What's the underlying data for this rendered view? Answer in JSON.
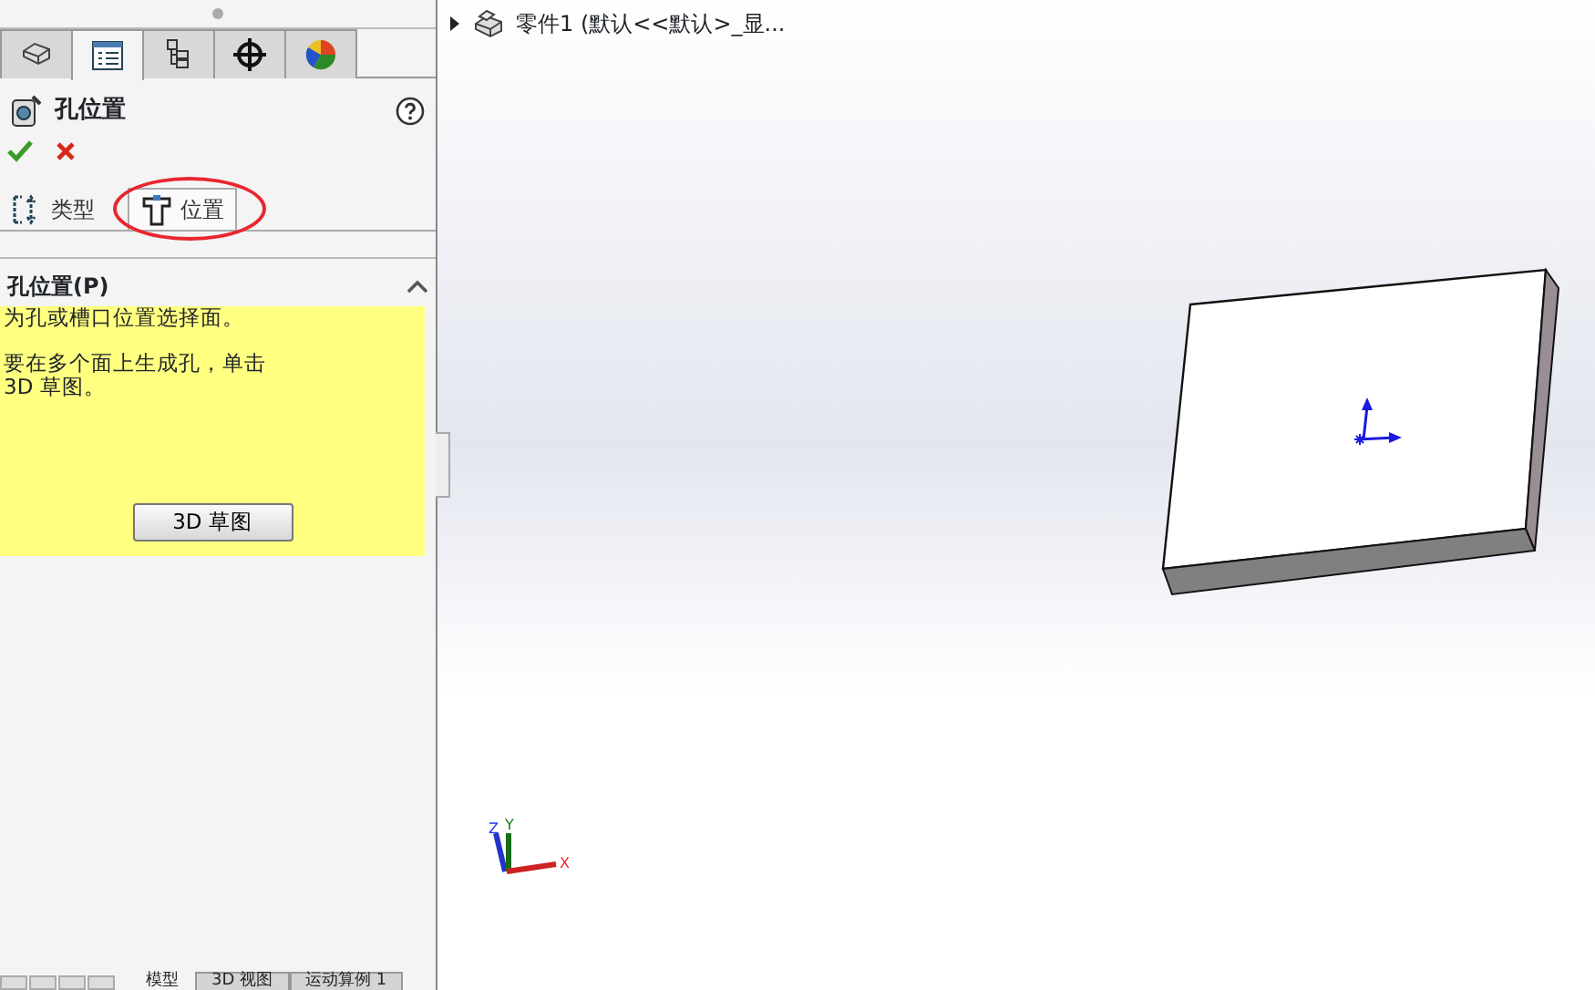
{
  "panel_tabs": [
    {
      "kind": "feature-tree",
      "selected": false
    },
    {
      "kind": "property",
      "selected": true
    },
    {
      "kind": "config",
      "selected": false
    },
    {
      "kind": "dimxpert",
      "selected": false
    },
    {
      "kind": "display",
      "selected": false
    }
  ],
  "property_manager": {
    "title": "孔位置"
  },
  "sub_tabs": [
    {
      "label": "类型",
      "kind": "type",
      "selected": false,
      "circled": false
    },
    {
      "label": "位置",
      "kind": "position",
      "selected": true,
      "circled": true
    }
  ],
  "section": {
    "title": "孔位置(P)",
    "expanded": true,
    "messages": [
      "为孔或槽口位置选择面。",
      "要在多个面上生成孔，单击\n3D 草图。"
    ],
    "button": "3D 草图"
  },
  "tree": {
    "label": "零件1  (默认<<默认>_显...",
    "expanded": false
  },
  "triad": {
    "x": "X",
    "y": "Y",
    "z": "Z"
  },
  "bottom_tabs": [
    {
      "label": "模型",
      "selected": true
    },
    {
      "label": "3D 视图",
      "selected": false
    },
    {
      "label": "运动算例 1",
      "selected": false
    }
  ]
}
